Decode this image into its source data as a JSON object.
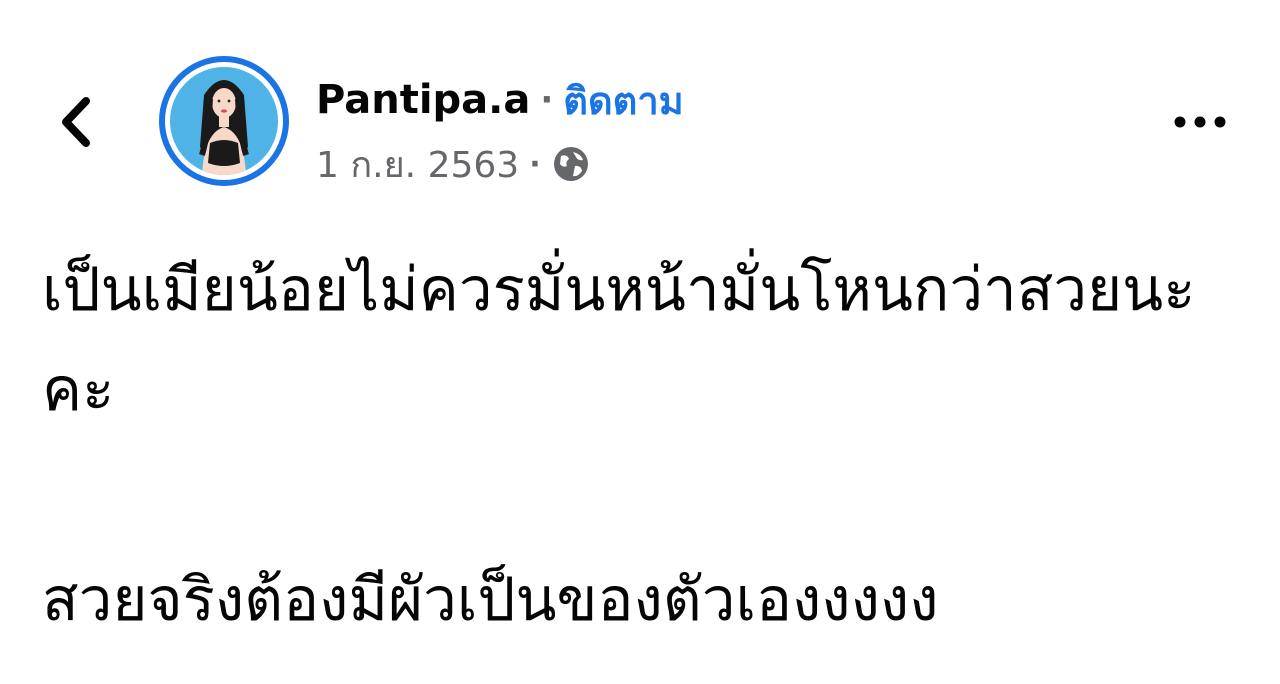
{
  "header": {
    "back_icon": "chevron-left-icon",
    "author_name": "Pantipa.a",
    "separator": "·",
    "follow_label": "ติดตาม",
    "date": "1 ก.ย. 2563",
    "privacy_icon": "globe-icon",
    "more_icon": "ellipsis-icon"
  },
  "post": {
    "paragraph1": "เป็นเมียน้อยไม่ควรมั่นหน้ามั่นโหนกว่าสวยนะคะ",
    "paragraph2": "สวยจริงต้องมีผัวเป็นของตัวเองงงงง"
  },
  "colors": {
    "link": "#1b74e4",
    "secondary_text": "#65676b",
    "avatar_ring": "#1b74e4",
    "avatar_bg": "#4fb3e8"
  }
}
